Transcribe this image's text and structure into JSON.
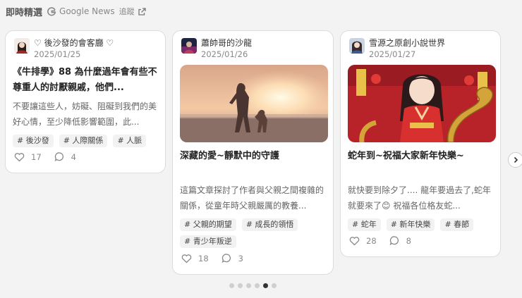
{
  "header": {
    "title": "即時精選",
    "source_label": "Google News",
    "follow_label": "追蹤"
  },
  "cards": [
    {
      "author": "♡ 後沙發的會客廳 ♡",
      "date": "2025/01/25",
      "title": "《牛排學》88 為什麼過年會有些不尊重人的討厭親戚，他們...",
      "excerpt": "不要讓這些人，妨礙、阻礙到我們的美好心情，至少降低影響範圍，此...",
      "tags": [
        "# 後沙發",
        "# 人際關係",
        "# 人脈"
      ],
      "likes": "17",
      "comments": "4"
    },
    {
      "author": "蕭帥哥的沙龍",
      "date": "2025/01/26",
      "title": "深藏的愛~靜默中的守護",
      "excerpt": "這篇文章探討了作者與父親之間複雜的關係，從童年時父親嚴厲的教養...",
      "tags": [
        "# 父親的期望",
        "# 成長的領悟",
        "# 青少年叛逆"
      ],
      "likes": "18",
      "comments": "3"
    },
    {
      "author": "雪源之原創小說世界",
      "date": "2025/01/27",
      "title": "蛇年到~祝福大家新年快樂~",
      "excerpt": "就快要到除夕了.... 龍年要過去了,蛇年就要來了😊 祝福各位格友蛇...",
      "tags": [
        "# 蛇年",
        "# 新年快樂",
        "# 春節"
      ],
      "likes": "28",
      "comments": "8"
    }
  ],
  "carousel": {
    "page_count": 6,
    "active_index": 4
  }
}
